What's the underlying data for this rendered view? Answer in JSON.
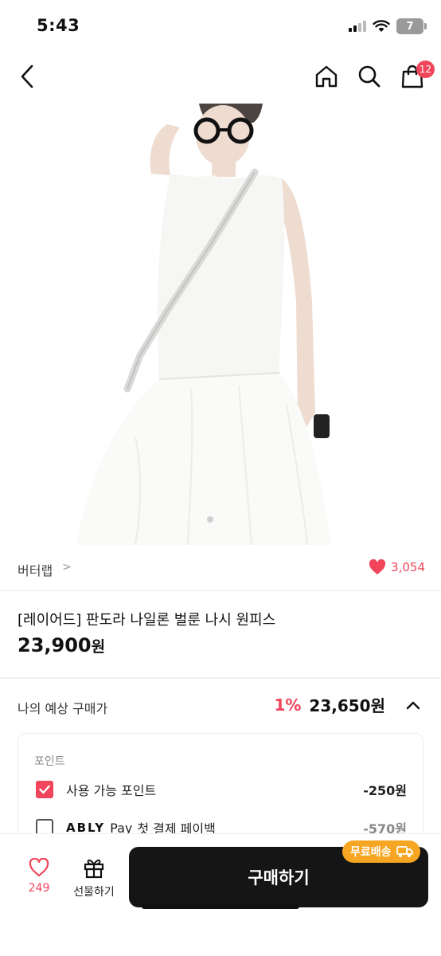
{
  "status_bar": {
    "time": "5:43",
    "battery": "7"
  },
  "nav": {
    "cart_count": "12"
  },
  "brand": {
    "name": "버터랩",
    "chevron": ">",
    "like_count": "3,054"
  },
  "product": {
    "title": "[레이어드] 판도라 나일론 벌룬 나시 원피스",
    "price": "23,900",
    "price_unit": "원"
  },
  "estimate": {
    "label": "나의 예상 구매가",
    "percent": "1%",
    "price": "23,650원"
  },
  "points": {
    "title": "포인트",
    "rows": [
      {
        "label": "사용 가능 포인트",
        "amount": "-250원",
        "checked": true
      },
      {
        "logo": "ABLY",
        "label_suffix": "Pay",
        "label_rest": "첫 결제 페이백",
        "amount": "-570원",
        "checked": false
      }
    ]
  },
  "bottom_bar": {
    "like_count": "249",
    "gift_label": "선물하기",
    "buy_label": "구매하기",
    "free_shipping_label": "무료배송"
  },
  "colors": {
    "accent": "#f0455a",
    "badge_orange": "#f7a623",
    "button_dark": "#151515"
  }
}
